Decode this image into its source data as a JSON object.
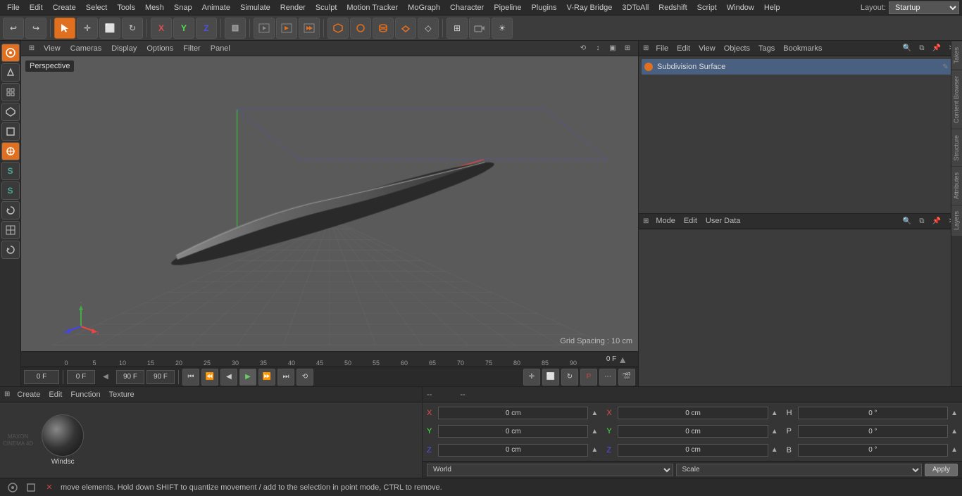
{
  "menubar": {
    "items": [
      "File",
      "Edit",
      "Create",
      "Select",
      "Tools",
      "Mesh",
      "Snap",
      "Animate",
      "Simulate",
      "Render",
      "Sculpt",
      "Motion Tracker",
      "MoGraph",
      "Character",
      "Pipeline",
      "Plugins",
      "V-Ray Bridge",
      "3DToAll",
      "Redshift",
      "Script",
      "Window",
      "Help"
    ],
    "layout_label": "Layout:",
    "layout_value": "Startup"
  },
  "toolbar": {
    "buttons": [
      {
        "name": "undo",
        "icon": "↩",
        "active": false
      },
      {
        "name": "redo",
        "icon": "↪",
        "active": false
      },
      {
        "name": "select",
        "icon": "⬡",
        "active": true
      },
      {
        "name": "move",
        "icon": "✛",
        "active": false
      },
      {
        "name": "scale",
        "icon": "⬜",
        "active": false
      },
      {
        "name": "rotate",
        "icon": "↻",
        "active": false
      },
      {
        "name": "x-axis",
        "icon": "X",
        "active": false
      },
      {
        "name": "y-axis",
        "icon": "Y",
        "active": false
      },
      {
        "name": "z-axis",
        "icon": "Z",
        "active": false
      },
      {
        "name": "object-mode",
        "icon": "◼",
        "active": false
      },
      {
        "name": "render-region",
        "icon": "▭",
        "active": false
      },
      {
        "name": "render-view",
        "icon": "▶",
        "active": false
      },
      {
        "name": "render-all",
        "icon": "▶▶",
        "active": false
      },
      {
        "name": "cube",
        "icon": "□",
        "active": false
      },
      {
        "name": "sphere",
        "icon": "○",
        "active": false
      },
      {
        "name": "move2",
        "icon": "⟳",
        "active": false
      },
      {
        "name": "polygon",
        "icon": "⬟",
        "active": false
      },
      {
        "name": "line",
        "icon": "◇",
        "active": false
      },
      {
        "name": "grid",
        "icon": "⊞",
        "active": false
      },
      {
        "name": "camera",
        "icon": "⬛",
        "active": false
      },
      {
        "name": "light",
        "icon": "☀",
        "active": false
      }
    ]
  },
  "left_sidebar": {
    "buttons": [
      {
        "name": "mode-1",
        "icon": "◈",
        "active": true
      },
      {
        "name": "mode-2",
        "icon": "▷",
        "active": false
      },
      {
        "name": "mode-3",
        "icon": "⊞",
        "active": false
      },
      {
        "name": "mode-4",
        "icon": "⬡",
        "active": false
      },
      {
        "name": "mode-5",
        "icon": "◻",
        "active": false
      },
      {
        "name": "mode-6",
        "icon": "◈",
        "active": false
      },
      {
        "name": "mode-7",
        "icon": "S",
        "active": false
      },
      {
        "name": "mode-8",
        "icon": "S",
        "active": false
      },
      {
        "name": "mode-9",
        "icon": "⟳",
        "active": false
      },
      {
        "name": "mode-10",
        "icon": "⊞",
        "active": false
      },
      {
        "name": "mode-11",
        "icon": "⟳",
        "active": false
      }
    ]
  },
  "viewport": {
    "label": "Perspective",
    "grid_spacing": "Grid Spacing : 10 cm",
    "menu_items": [
      "View",
      "Cameras",
      "Display",
      "Options",
      "Filter",
      "Panel"
    ]
  },
  "timeline": {
    "frame_current": "0 F",
    "frame_start": "0 F",
    "frame_end": "90 F",
    "ticks": [
      0,
      5,
      10,
      15,
      20,
      25,
      30,
      35,
      40,
      45,
      50,
      55,
      60,
      65,
      70,
      75,
      80,
      85,
      90
    ],
    "right_frame": "0 F"
  },
  "timeline_controls": {
    "frame_field": "0 F",
    "min_field": "0 F",
    "max_field": "90 F",
    "max2_field": "90 F",
    "buttons": [
      "⏮",
      "⏪",
      "⏴",
      "⏵",
      "⏩",
      "⏭",
      "⟲"
    ]
  },
  "objects_panel": {
    "header_menus": [
      "File",
      "Edit",
      "View",
      "Objects",
      "Tags",
      "Bookmarks"
    ],
    "objects": [
      {
        "name": "Subdivision Surface",
        "dot_color": "#e07020",
        "active": true,
        "icons": [
          "✎",
          "✓"
        ]
      }
    ]
  },
  "attributes_panel": {
    "header_menus": [
      "Mode",
      "Edit",
      "User Data"
    ],
    "content": ""
  },
  "material_panel": {
    "header_menus": [
      "Create",
      "Edit",
      "Function",
      "Texture"
    ],
    "ball_label": "Windsc"
  },
  "coords_panel": {
    "dash1": "--",
    "dash2": "--",
    "rows": [
      {
        "label": "X",
        "val1": "0 cm",
        "arr1": "▲",
        "label2": "X",
        "val2": "0 cm",
        "arr2": "▲",
        "label3": "H",
        "val3": "0°",
        "arr3": "▲"
      },
      {
        "label": "Y",
        "val1": "0 cm",
        "arr1": "▲",
        "label2": "Y",
        "val2": "0 cm",
        "arr2": "▲",
        "label3": "P",
        "val3": "0°",
        "arr3": "▲"
      },
      {
        "label": "Z",
        "val1": "0 cm",
        "arr1": "▲",
        "label2": "Z",
        "val2": "0 cm",
        "arr2": "▲",
        "label3": "B",
        "val3": "0°",
        "arr3": "▲"
      }
    ],
    "world_label": "World",
    "scale_label": "Scale",
    "apply_label": "Apply"
  },
  "status_bar": {
    "text": "move elements. Hold down SHIFT to quantize movement / add to the selection in point mode, CTRL to remove.",
    "icons": [
      "⬡",
      "□",
      "✕"
    ]
  },
  "right_tabs": [
    "Takes",
    "Content Browser",
    "Structure",
    "Attributes",
    "Layers"
  ]
}
